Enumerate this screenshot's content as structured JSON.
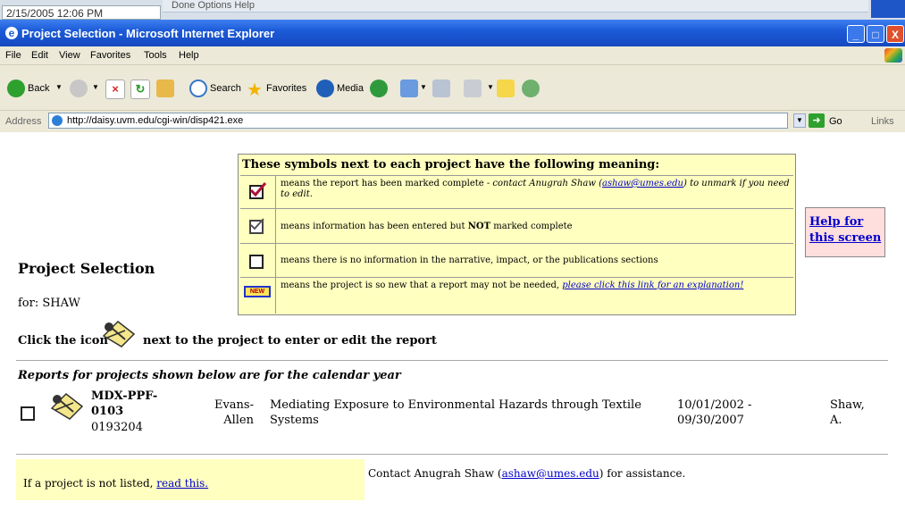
{
  "background_window": {
    "timestamp": "2/15/2005 12:06 PM",
    "toolbar_text": "Done    Options    Help"
  },
  "window": {
    "title": "Project Selection - Microsoft Internet Explorer",
    "controls": {
      "minimize": "_",
      "maximize": "□",
      "close": "X"
    }
  },
  "menu": [
    "File",
    "Edit",
    "View",
    "Favorites",
    "Tools",
    "Help"
  ],
  "toolbar": {
    "back_label": "Back",
    "search_label": "Search",
    "favorites_label": "Favorites",
    "media_label": "Media"
  },
  "address": {
    "label": "Address",
    "url": "http://daisy.uvm.edu/cgi-win/disp421.exe",
    "go_label": "Go",
    "links_label": "Links"
  },
  "page": {
    "heading": "Project Selection",
    "for_label": "for: SHAW",
    "instruction_before": "Click the icon",
    "instruction_after": "next to the project to enter or edit the report",
    "reports_note": "Reports for projects shown below are for the calendar year",
    "help_link_line1": "Help for",
    "help_link_line2": "this screen"
  },
  "legend": {
    "heading": "These symbols next to each project have the following meaning:",
    "complete_text": "means the report has been marked complete - ",
    "complete_contact_before": "contact Anugrah Shaw (",
    "complete_email": "ashaw@umes.edu",
    "complete_contact_after": ") to unmark if you need to edit.",
    "incomplete_text_before": "means information has been entered but ",
    "incomplete_text_bold": "NOT",
    "incomplete_text_after": " marked complete",
    "empty_text": "means there is no information in the narrative, impact, or the publications sections",
    "new_badge": "NEW",
    "new_text": "means the project is so new that a report may not be needed, ",
    "new_link": "please click this link for an explanation!"
  },
  "project": {
    "id_line1": "MDX-PPF-",
    "id_line2": "0103",
    "number": "0193204",
    "institution_line1": "Evans-",
    "institution_line2": "Allen",
    "title_line1": "Mediating Exposure to Environmental Hazards through Textile",
    "title_line2": "Systems",
    "start": "10/01/2002 -",
    "end": "09/30/2007",
    "pi_line1": "Shaw,",
    "pi_line2": "A."
  },
  "footer": {
    "not_listed_text": "If a project is not listed, ",
    "not_listed_link": "read this.",
    "contact_before": "Contact Anugrah Shaw (",
    "contact_email": "ashaw@umes.edu",
    "contact_after": ") for assistance."
  }
}
